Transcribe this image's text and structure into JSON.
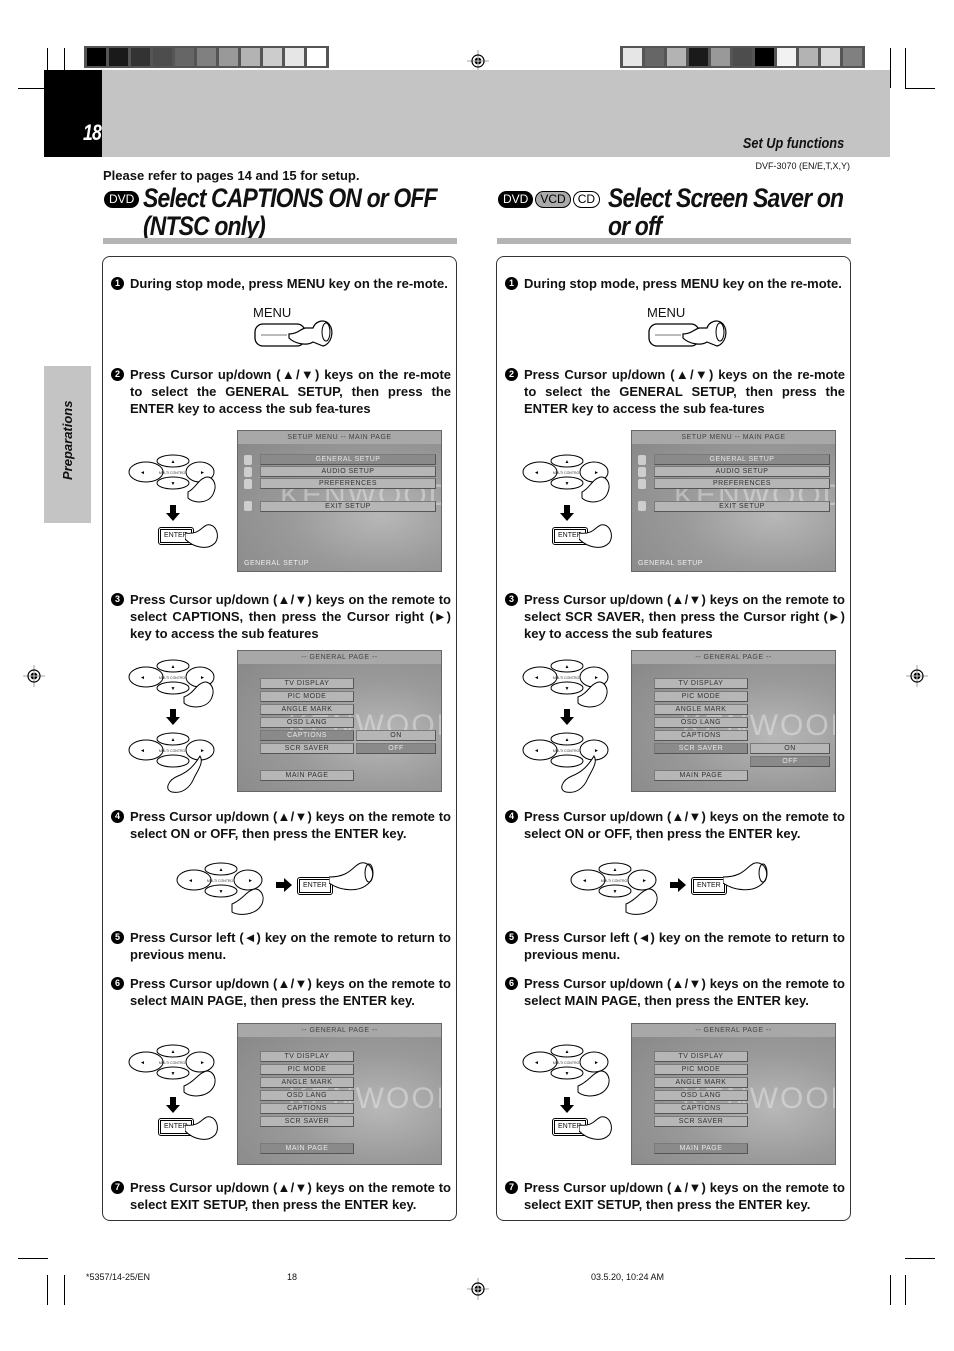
{
  "print_marks": {
    "colorbar_left": [
      "#000000",
      "#1a1a1a",
      "#333333",
      "#4d4d4d",
      "#666666",
      "#808080",
      "#999999",
      "#b3b3b3",
      "#cccccc",
      "#e6e6e6",
      "#ffffff"
    ],
    "colorbar_right": [
      "#e6e6e6",
      "#666666",
      "#b3b3b3",
      "#1a1a1a",
      "#999999",
      "#4d4d4d",
      "#000000",
      "#f2f2f2",
      "#b3b3b3",
      "#d9d9d9",
      "#808080"
    ]
  },
  "header": {
    "page_number": "18",
    "section": "Set Up functions",
    "model_code": "DVF-3070 (EN/E,T,X,Y)",
    "side_tab": "Preparations"
  },
  "refer_note": "Please refer to pages 14 and 15 for setup.",
  "left_section": {
    "discs": [
      "DVD"
    ],
    "title_line1": "Select CAPTIONS ON or OFF",
    "title_line2": "(NTSC only)",
    "steps": [
      {
        "num": "1",
        "text": "During stop mode, press MENU key on the re-mote."
      },
      {
        "num": "2",
        "text": "Press Cursor up/down (▲/▼) keys on the re-mote to select the GENERAL SETUP, then press the ENTER key to access the sub fea-tures"
      },
      {
        "num": "3",
        "text": "Press Cursor up/down (▲/▼) keys on the remote to select CAPTIONS, then press the Cursor right (►) key to access the sub features"
      },
      {
        "num": "4",
        "text": "Press Cursor up/down (▲/▼) keys on the remote to select ON or OFF, then press the ENTER key."
      },
      {
        "num": "5",
        "text": "Press Cursor left (◄) key on the remote to return to previous menu."
      },
      {
        "num": "6",
        "text": "Press Cursor up/down (▲/▼) keys on the remote to select MAIN PAGE, then press the ENTER key."
      },
      {
        "num": "7",
        "text": "Press Cursor up/down (▲/▼) keys on the remote to select EXIT SETUP, then press the ENTER key."
      }
    ],
    "submenu_highlight": "CAPTIONS"
  },
  "right_section": {
    "discs": [
      "DVD",
      "VCD",
      "CD"
    ],
    "title_line1": "Select Screen Saver on",
    "title_line2": "or off",
    "steps": [
      {
        "num": "1",
        "text": "During stop mode, press MENU key on the re-mote."
      },
      {
        "num": "2",
        "text": "Press Cursor up/down (▲/▼) keys on the re-mote to select the GENERAL SETUP, then press the ENTER key to access the sub fea-tures"
      },
      {
        "num": "3",
        "text": "Press Cursor up/down (▲/▼) keys on the remote to select SCR SAVER, then press the Cursor right (►) key to access the sub features"
      },
      {
        "num": "4",
        "text": "Press Cursor up/down (▲/▼) keys on the remote to select ON or OFF, then press the ENTER key."
      },
      {
        "num": "5",
        "text": "Press Cursor left (◄) key on the remote to return to previous menu."
      },
      {
        "num": "6",
        "text": "Press Cursor up/down (▲/▼) keys on the remote to select MAIN PAGE, then press the ENTER key."
      },
      {
        "num": "7",
        "text": "Press Cursor up/down (▲/▼) keys on the remote to select EXIT SETUP, then press the ENTER key."
      }
    ],
    "submenu_highlight": "SCR SAVER"
  },
  "figures": {
    "menu_key_label": "MENU",
    "enter_key_label": "ENTER",
    "multi_control_label": "MULTI CONTROL",
    "main_menu": {
      "title": "SETUP MENU -- MAIN PAGE",
      "items": [
        "GENERAL SETUP",
        "AUDIO SETUP",
        "PREFERENCES",
        "EXIT SETUP"
      ],
      "selected": "GENERAL SETUP",
      "footer": "GENERAL SETUP",
      "watermark": "KENWOOD"
    },
    "general_page": {
      "title": "-- GENERAL PAGE --",
      "items": [
        "TV DISPLAY",
        "PIC MODE",
        "ANGLE MARK",
        "OSD LANG",
        "CAPTIONS",
        "SCR SAVER",
        "MAIN PAGE"
      ],
      "options": [
        "ON",
        "OFF"
      ],
      "selected_option": "OFF",
      "main_page_selected": "MAIN PAGE",
      "watermark": "KENWOOD"
    }
  },
  "footer": {
    "job_code": "*5357/14-25/EN",
    "page": "18",
    "timestamp": "03.5.20, 10:24 AM"
  }
}
